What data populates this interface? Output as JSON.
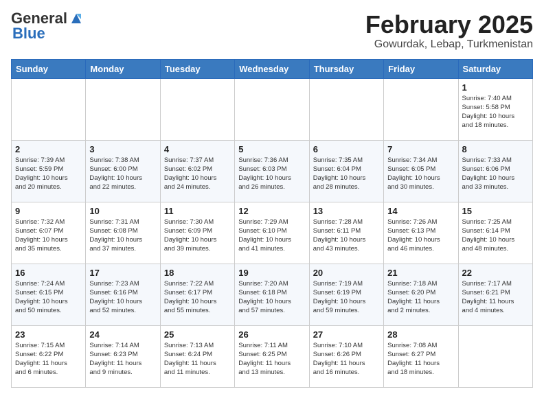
{
  "header": {
    "logo_general": "General",
    "logo_blue": "Blue",
    "title": "February 2025",
    "subtitle": "Gowurdak, Lebap, Turkmenistan"
  },
  "days_of_week": [
    "Sunday",
    "Monday",
    "Tuesday",
    "Wednesday",
    "Thursday",
    "Friday",
    "Saturday"
  ],
  "weeks": [
    [
      {
        "num": "",
        "info": ""
      },
      {
        "num": "",
        "info": ""
      },
      {
        "num": "",
        "info": ""
      },
      {
        "num": "",
        "info": ""
      },
      {
        "num": "",
        "info": ""
      },
      {
        "num": "",
        "info": ""
      },
      {
        "num": "1",
        "info": "Sunrise: 7:40 AM\nSunset: 5:58 PM\nDaylight: 10 hours\nand 18 minutes."
      }
    ],
    [
      {
        "num": "2",
        "info": "Sunrise: 7:39 AM\nSunset: 5:59 PM\nDaylight: 10 hours\nand 20 minutes."
      },
      {
        "num": "3",
        "info": "Sunrise: 7:38 AM\nSunset: 6:00 PM\nDaylight: 10 hours\nand 22 minutes."
      },
      {
        "num": "4",
        "info": "Sunrise: 7:37 AM\nSunset: 6:02 PM\nDaylight: 10 hours\nand 24 minutes."
      },
      {
        "num": "5",
        "info": "Sunrise: 7:36 AM\nSunset: 6:03 PM\nDaylight: 10 hours\nand 26 minutes."
      },
      {
        "num": "6",
        "info": "Sunrise: 7:35 AM\nSunset: 6:04 PM\nDaylight: 10 hours\nand 28 minutes."
      },
      {
        "num": "7",
        "info": "Sunrise: 7:34 AM\nSunset: 6:05 PM\nDaylight: 10 hours\nand 30 minutes."
      },
      {
        "num": "8",
        "info": "Sunrise: 7:33 AM\nSunset: 6:06 PM\nDaylight: 10 hours\nand 33 minutes."
      }
    ],
    [
      {
        "num": "9",
        "info": "Sunrise: 7:32 AM\nSunset: 6:07 PM\nDaylight: 10 hours\nand 35 minutes."
      },
      {
        "num": "10",
        "info": "Sunrise: 7:31 AM\nSunset: 6:08 PM\nDaylight: 10 hours\nand 37 minutes."
      },
      {
        "num": "11",
        "info": "Sunrise: 7:30 AM\nSunset: 6:09 PM\nDaylight: 10 hours\nand 39 minutes."
      },
      {
        "num": "12",
        "info": "Sunrise: 7:29 AM\nSunset: 6:10 PM\nDaylight: 10 hours\nand 41 minutes."
      },
      {
        "num": "13",
        "info": "Sunrise: 7:28 AM\nSunset: 6:11 PM\nDaylight: 10 hours\nand 43 minutes."
      },
      {
        "num": "14",
        "info": "Sunrise: 7:26 AM\nSunset: 6:13 PM\nDaylight: 10 hours\nand 46 minutes."
      },
      {
        "num": "15",
        "info": "Sunrise: 7:25 AM\nSunset: 6:14 PM\nDaylight: 10 hours\nand 48 minutes."
      }
    ],
    [
      {
        "num": "16",
        "info": "Sunrise: 7:24 AM\nSunset: 6:15 PM\nDaylight: 10 hours\nand 50 minutes."
      },
      {
        "num": "17",
        "info": "Sunrise: 7:23 AM\nSunset: 6:16 PM\nDaylight: 10 hours\nand 52 minutes."
      },
      {
        "num": "18",
        "info": "Sunrise: 7:22 AM\nSunset: 6:17 PM\nDaylight: 10 hours\nand 55 minutes."
      },
      {
        "num": "19",
        "info": "Sunrise: 7:20 AM\nSunset: 6:18 PM\nDaylight: 10 hours\nand 57 minutes."
      },
      {
        "num": "20",
        "info": "Sunrise: 7:19 AM\nSunset: 6:19 PM\nDaylight: 10 hours\nand 59 minutes."
      },
      {
        "num": "21",
        "info": "Sunrise: 7:18 AM\nSunset: 6:20 PM\nDaylight: 11 hours\nand 2 minutes."
      },
      {
        "num": "22",
        "info": "Sunrise: 7:17 AM\nSunset: 6:21 PM\nDaylight: 11 hours\nand 4 minutes."
      }
    ],
    [
      {
        "num": "23",
        "info": "Sunrise: 7:15 AM\nSunset: 6:22 PM\nDaylight: 11 hours\nand 6 minutes."
      },
      {
        "num": "24",
        "info": "Sunrise: 7:14 AM\nSunset: 6:23 PM\nDaylight: 11 hours\nand 9 minutes."
      },
      {
        "num": "25",
        "info": "Sunrise: 7:13 AM\nSunset: 6:24 PM\nDaylight: 11 hours\nand 11 minutes."
      },
      {
        "num": "26",
        "info": "Sunrise: 7:11 AM\nSunset: 6:25 PM\nDaylight: 11 hours\nand 13 minutes."
      },
      {
        "num": "27",
        "info": "Sunrise: 7:10 AM\nSunset: 6:26 PM\nDaylight: 11 hours\nand 16 minutes."
      },
      {
        "num": "28",
        "info": "Sunrise: 7:08 AM\nSunset: 6:27 PM\nDaylight: 11 hours\nand 18 minutes."
      },
      {
        "num": "",
        "info": ""
      }
    ]
  ]
}
